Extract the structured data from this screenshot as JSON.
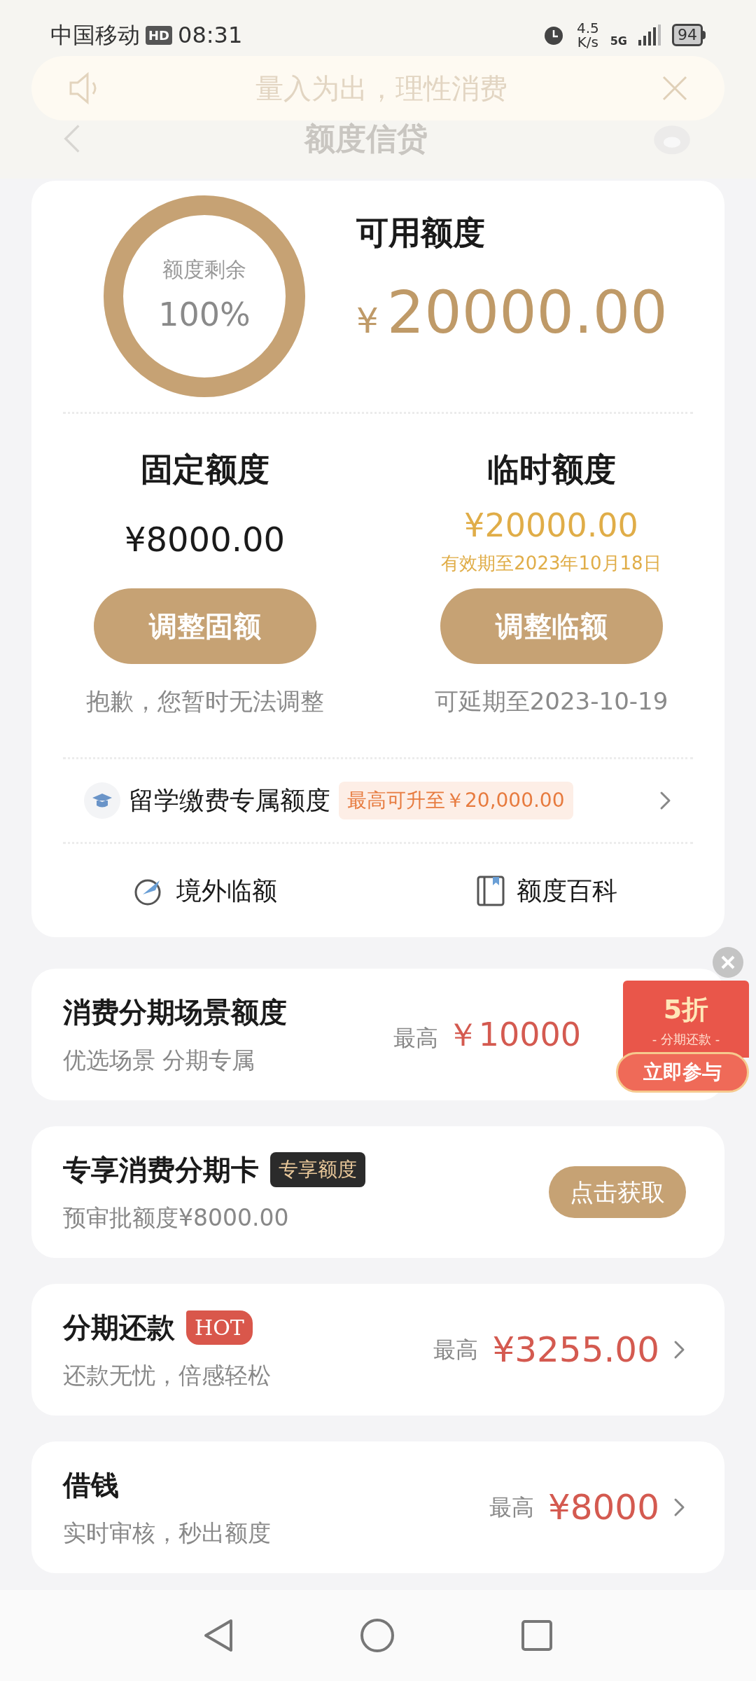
{
  "status_bar": {
    "carrier": "中国移动",
    "hd": "HD",
    "time": "08:31",
    "speed": "4.5",
    "speed_unit": "K/s",
    "network": "5G",
    "battery": "94"
  },
  "header": {
    "title": "额度信贷"
  },
  "notice": {
    "text": "量入为出，理性消费"
  },
  "quota": {
    "ring_label": "额度剩余",
    "ring_percent": "100%",
    "level": 1,
    "available_label": "可用额度",
    "currency": "¥",
    "available_amount": "20000.00",
    "columns": [
      {
        "kind": "fixed",
        "title": "固定额度",
        "amount": "¥8000.00",
        "button": "调整固额",
        "note": "抱歉，您暂时无法调整"
      },
      {
        "kind": "temporary",
        "title": "临时额度",
        "amount": "¥20000.00",
        "validity": "有效期至2023年10月18日",
        "button": "调整临额",
        "note": "可延期至2023-10-19"
      }
    ],
    "study": {
      "label": "留学缴费专属额度",
      "tag": "最高可升至￥20,000.00"
    },
    "links": [
      {
        "kind": "overseas",
        "label": "境外临额"
      },
      {
        "kind": "wiki",
        "label": "额度百科"
      }
    ]
  },
  "products": [
    {
      "kind": "scene",
      "title": "消费分期场景额度",
      "subtitle": "优选场景 分期专属",
      "prefix": "最高",
      "amount": "￥10000"
    },
    {
      "kind": "card",
      "title": "专享消费分期卡",
      "badge": "专享额度",
      "subtitle": "预审批额度¥8000.00",
      "button": "点击获取"
    },
    {
      "kind": "repay",
      "title": "分期还款",
      "badge": "HOT",
      "subtitle": "还款无忧，倍感轻松",
      "prefix": "最高",
      "amount": "¥3255.00"
    },
    {
      "kind": "loan",
      "title": "借钱",
      "subtitle": "实时审核，秒出额度",
      "prefix": "最高",
      "amount": "¥8000"
    }
  ],
  "promo": {
    "discount": "5折",
    "caption": "- 分期还款 -",
    "button": "立即参与"
  }
}
